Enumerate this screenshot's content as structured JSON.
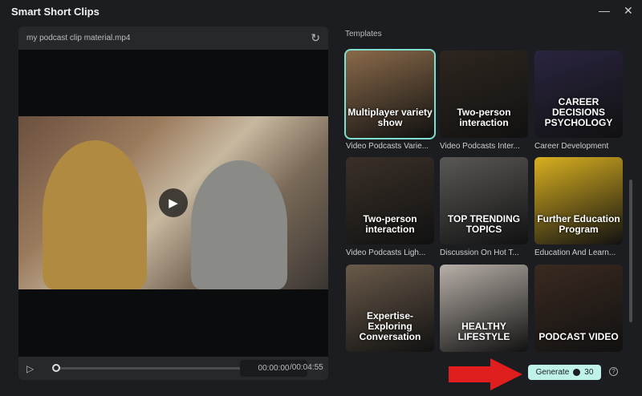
{
  "window": {
    "title": "Smart Short Clips",
    "minimize": "—",
    "close": "✕"
  },
  "preview": {
    "filename": "my podcast clip material.mp4",
    "reset_icon": "refresh-icon",
    "current_time": "00:00:00",
    "total_time": "/00:04:55",
    "progress": 0
  },
  "templates": {
    "label": "Templates",
    "items": [
      {
        "caption": "Video Podcasts Varie...",
        "overlay": "Multiplayer variety show",
        "bg": "#8a6a4a"
      },
      {
        "caption": "Video Podcasts Inter...",
        "overlay": "Two-person interaction",
        "bg": "#2e261f"
      },
      {
        "caption": "Career Development",
        "overlay": "CAREER DECISIONS PSYCHOLOGY",
        "bg": "#2a2440"
      },
      {
        "caption": "Video Podcasts Ligh...",
        "overlay": "Two-person interaction",
        "bg": "#3a3028"
      },
      {
        "caption": "Discussion On Hot T...",
        "overlay": "TOP TRENDING TOPICS",
        "bg": "#5a5856"
      },
      {
        "caption": "Education And Learn...",
        "overlay": "Further Education Program",
        "bg": "#d9b020"
      },
      {
        "caption": "",
        "overlay": "Expertise-Exploring Conversation",
        "bg": "#6a5a4a"
      },
      {
        "caption": "",
        "overlay": "HEALTHY LIFESTYLE",
        "bg": "#b8b0a8"
      },
      {
        "caption": "",
        "overlay": "PODCAST VIDEO",
        "bg": "#3a2a20"
      }
    ]
  },
  "generate": {
    "label": "Generate",
    "cost": "30",
    "accent": "#bff3ea"
  },
  "help": "?"
}
